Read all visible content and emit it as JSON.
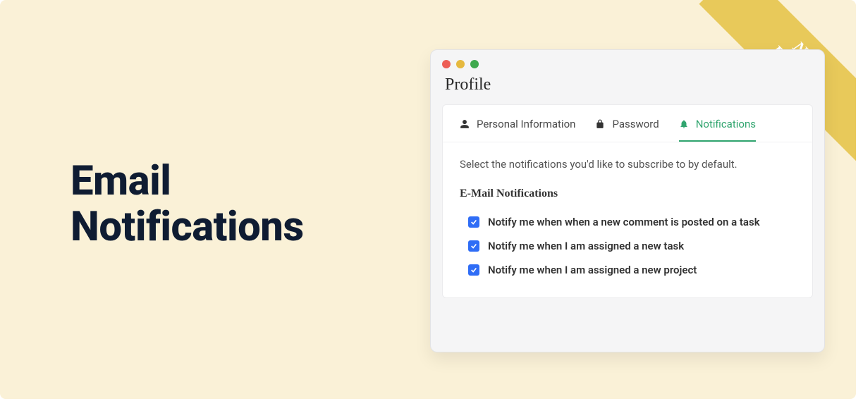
{
  "ribbon": {
    "line1": "New",
    "line2": "Feature"
  },
  "headline": {
    "line1": "Email",
    "line2": "Notifications"
  },
  "window": {
    "title": "Profile"
  },
  "tabs": {
    "personal": "Personal Information",
    "password": "Password",
    "notifications": "Notifications"
  },
  "content": {
    "description": "Select the notifications you'd like to subscribe to by default.",
    "section_title": "E-Mail Notifications",
    "options": [
      {
        "label": "Notify me when when a new comment is posted on a task",
        "checked": true
      },
      {
        "label": "Notify me when I am assigned a new task",
        "checked": true
      },
      {
        "label": "Notify me when I am assigned a new project",
        "checked": true
      }
    ]
  },
  "colors": {
    "accent_green": "#31a56f",
    "checkbox_blue": "#2f6df6",
    "ribbon_gold": "#e8c95a",
    "hero_bg": "#faf1d7",
    "headline": "#0f1c32"
  }
}
